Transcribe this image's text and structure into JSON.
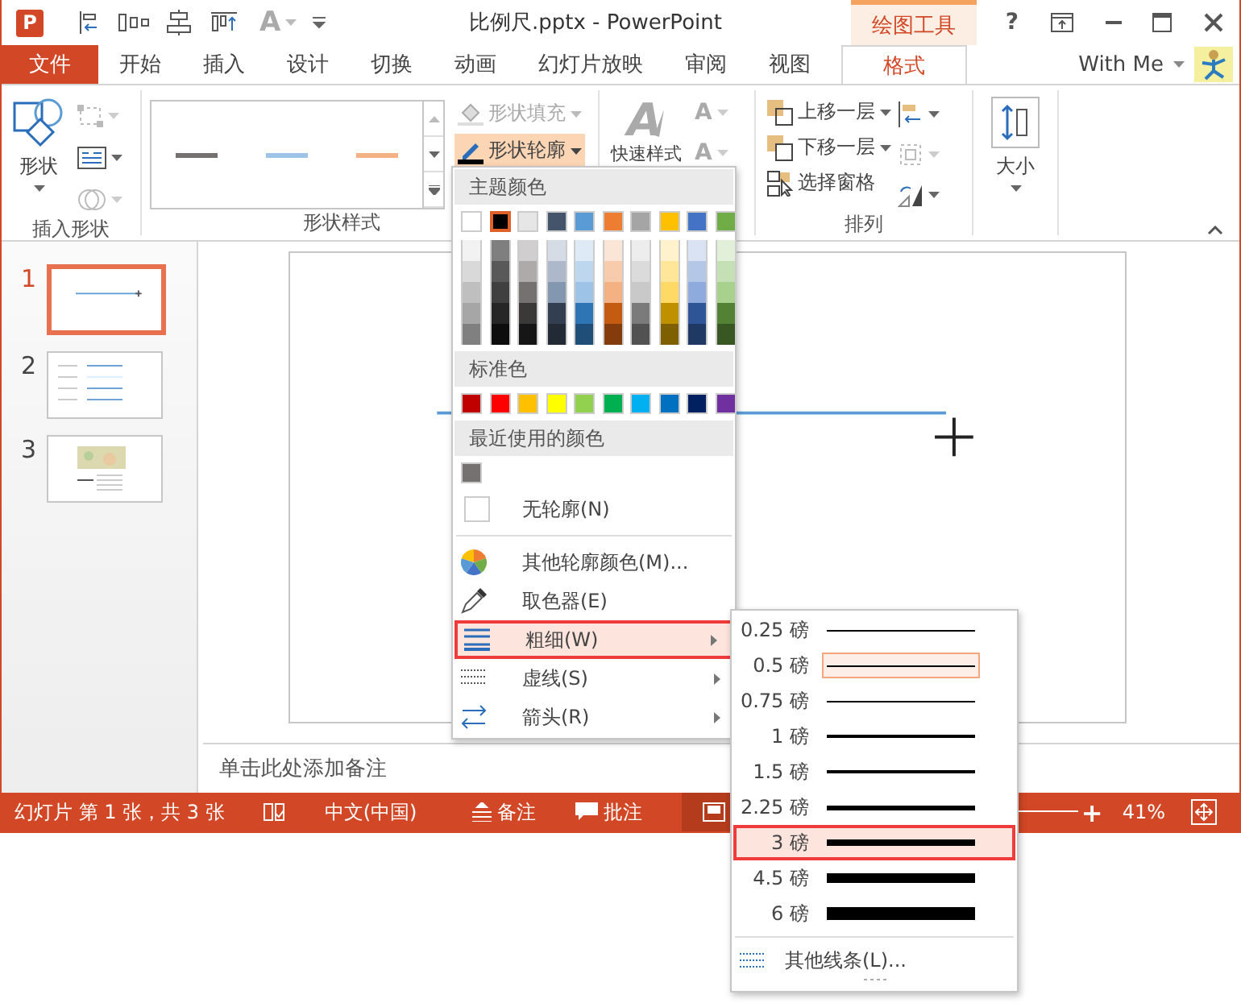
{
  "window": {
    "app_logo": "P",
    "title": "比例尺.pptx - PowerPoint",
    "context_tab": "绘图工具",
    "help": "?",
    "account": "With Me"
  },
  "quick_access": {
    "font_button": "A"
  },
  "tabs": [
    {
      "label": "文件",
      "kind": "file",
      "selected": false
    },
    {
      "label": "开始",
      "kind": "tab",
      "selected": false
    },
    {
      "label": "插入",
      "kind": "tab",
      "selected": false
    },
    {
      "label": "设计",
      "kind": "tab",
      "selected": false
    },
    {
      "label": "切换",
      "kind": "tab",
      "selected": false
    },
    {
      "label": "动画",
      "kind": "tab",
      "selected": false
    },
    {
      "label": "幻灯片放映",
      "kind": "tab",
      "selected": false
    },
    {
      "label": "审阅",
      "kind": "tab",
      "selected": false
    },
    {
      "label": "视图",
      "kind": "tab",
      "selected": false
    },
    {
      "label": "格式",
      "kind": "context",
      "selected": true
    }
  ],
  "ribbon": {
    "insert_shapes": {
      "shape_button": "形状",
      "label": "插入形状"
    },
    "shape_styles": {
      "presets": [
        {
          "color": "#767171"
        },
        {
          "color": "#9dc3e6"
        },
        {
          "color": "#f4b183"
        }
      ],
      "fill_button": {
        "label": "形状填充",
        "disabled": true
      },
      "outline_button": {
        "label": "形状轮廓",
        "expanded": true
      },
      "label": "形状样式"
    },
    "wordart": {
      "big_glyph": "A",
      "label": "快速样式",
      "glyphs": [
        "A",
        "A"
      ]
    },
    "arrange": {
      "buttons": [
        {
          "label": "上移一层",
          "kind": "forward"
        },
        {
          "label": "下移一层",
          "kind": "backward"
        },
        {
          "label": "选择窗格",
          "kind": "pane"
        }
      ],
      "label": "排列"
    },
    "size": {
      "label": "大小"
    }
  },
  "slides": [
    {
      "number": "1",
      "selected": true,
      "kind": "line"
    },
    {
      "number": "2",
      "selected": false,
      "kind": "list"
    },
    {
      "number": "3",
      "selected": false,
      "kind": "map"
    }
  ],
  "notes_placeholder": "单击此处添加备注",
  "outline_menu": {
    "theme_header": "主题颜色",
    "theme_colors": [
      {
        "color": "#ffffff",
        "selected": false
      },
      {
        "color": "#000000",
        "selected": true
      },
      {
        "color": "#e7e6e6",
        "selected": false
      },
      {
        "color": "#44546a",
        "selected": false
      },
      {
        "color": "#5b9bd5",
        "selected": false
      },
      {
        "color": "#ed7d31",
        "selected": false
      },
      {
        "color": "#a5a5a5",
        "selected": false
      },
      {
        "color": "#ffc000",
        "selected": false
      },
      {
        "color": "#4472c4",
        "selected": false
      },
      {
        "color": "#70ad47",
        "selected": false
      }
    ],
    "shades": [
      [
        {
          "color": "#f2f2f2"
        },
        {
          "color": "#d9d9d9"
        },
        {
          "color": "#bfbfbf"
        },
        {
          "color": "#a6a6a6"
        },
        {
          "color": "#808080"
        }
      ],
      [
        {
          "color": "#7f7f7f"
        },
        {
          "color": "#595959"
        },
        {
          "color": "#404040"
        },
        {
          "color": "#262626"
        },
        {
          "color": "#0d0d0d"
        }
      ],
      [
        {
          "color": "#d0cece"
        },
        {
          "color": "#aeaaaa"
        },
        {
          "color": "#757171"
        },
        {
          "color": "#3b3838"
        },
        {
          "color": "#171616"
        }
      ],
      [
        {
          "color": "#d6dce5"
        },
        {
          "color": "#adb9ca"
        },
        {
          "color": "#8497b0"
        },
        {
          "color": "#333f50"
        },
        {
          "color": "#222a35"
        }
      ],
      [
        {
          "color": "#deebf7"
        },
        {
          "color": "#bdd7ee"
        },
        {
          "color": "#9dc3e6"
        },
        {
          "color": "#2e75b6"
        },
        {
          "color": "#1f4e79"
        }
      ],
      [
        {
          "color": "#fbe5d6"
        },
        {
          "color": "#f8cbad"
        },
        {
          "color": "#f4b183"
        },
        {
          "color": "#c55a11"
        },
        {
          "color": "#843c0c"
        }
      ],
      [
        {
          "color": "#ededed"
        },
        {
          "color": "#dbdbdb"
        },
        {
          "color": "#c9c9c9"
        },
        {
          "color": "#7b7b7b"
        },
        {
          "color": "#525252"
        }
      ],
      [
        {
          "color": "#fff2cc"
        },
        {
          "color": "#ffe699"
        },
        {
          "color": "#ffd966"
        },
        {
          "color": "#bf9000"
        },
        {
          "color": "#7f6000"
        }
      ],
      [
        {
          "color": "#dae3f3"
        },
        {
          "color": "#b4c7e7"
        },
        {
          "color": "#8faadc"
        },
        {
          "color": "#2f5597"
        },
        {
          "color": "#203864"
        }
      ],
      [
        {
          "color": "#e2f0d9"
        },
        {
          "color": "#c5e0b4"
        },
        {
          "color": "#a9d18e"
        },
        {
          "color": "#548235"
        },
        {
          "color": "#385723"
        }
      ]
    ],
    "standard_header": "标准色",
    "standard_colors": [
      {
        "color": "#c00000"
      },
      {
        "color": "#ff0000"
      },
      {
        "color": "#ffc000"
      },
      {
        "color": "#ffff00"
      },
      {
        "color": "#92d050"
      },
      {
        "color": "#00b050"
      },
      {
        "color": "#00b0f0"
      },
      {
        "color": "#0070c0"
      },
      {
        "color": "#002060"
      },
      {
        "color": "#7030a0"
      }
    ],
    "recent_header": "最近使用的颜色",
    "recent_colors": [
      {
        "color": "#767171"
      }
    ],
    "no_outline": "无轮廓(N)",
    "items": [
      {
        "label": "其他轮廓颜色(M)...",
        "kind": "palette",
        "submenu": false,
        "highlighted": false
      },
      {
        "label": "取色器(E)",
        "kind": "eyedropper",
        "submenu": false,
        "highlighted": false
      },
      {
        "label": "粗细(W)",
        "kind": "weight",
        "submenu": true,
        "highlighted": true
      },
      {
        "label": "虚线(S)",
        "kind": "dash",
        "submenu": true,
        "highlighted": false
      },
      {
        "label": "箭头(R)",
        "kind": "arrow",
        "submenu": true,
        "highlighted": false
      }
    ]
  },
  "weight_menu": {
    "items": [
      {
        "label": "0.25 磅",
        "current": false,
        "highlighted": false
      },
      {
        "label": "0.5 磅",
        "current": true,
        "highlighted": false
      },
      {
        "label": "0.75 磅",
        "current": false,
        "highlighted": false
      },
      {
        "label": "1 磅",
        "current": false,
        "highlighted": false
      },
      {
        "label": "1.5 磅",
        "current": false,
        "highlighted": false
      },
      {
        "label": "2.25 磅",
        "current": false,
        "highlighted": false
      },
      {
        "label": "3 磅",
        "current": false,
        "highlighted": true
      },
      {
        "label": "4.5 磅",
        "current": false,
        "highlighted": false
      },
      {
        "label": "6 磅",
        "current": false,
        "highlighted": false
      }
    ],
    "more": "其他线条(L)..."
  },
  "status_bar": {
    "slide_info": "幻灯片 第 1 张，共 3 张",
    "language": "中文(中国)",
    "notes": "备注",
    "comments": "批注",
    "zoom_in": "+",
    "zoom": "41%"
  }
}
